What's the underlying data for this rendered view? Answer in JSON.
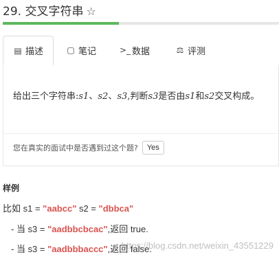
{
  "header": {
    "title": "29. 交叉字符串",
    "star_icon": "star-outline-icon",
    "progress_fraction": 0.42
  },
  "tabs": [
    {
      "label": "描述",
      "icon": "document-icon",
      "glyph": "▤",
      "active": true
    },
    {
      "label": "笔记",
      "icon": "note-icon",
      "glyph": "▢",
      "active": false
    },
    {
      "label": "数据",
      "icon": "terminal-icon",
      "glyph": ">_",
      "active": false
    },
    {
      "label": "评测",
      "icon": "scale-icon",
      "glyph": "⚖",
      "active": false
    }
  ],
  "problem": {
    "statement_parts": [
      "给出三个字符串:",
      "s1",
      "、",
      "s2",
      "、",
      "s3",
      ",判断",
      "s3",
      "是否由",
      "s1",
      "和",
      "s2",
      "交叉构成。"
    ],
    "question": "您在真实的面试中是否遇到过这个题?",
    "yes_button": "Yes"
  },
  "examples": {
    "header": "样例",
    "line1": {
      "prefix": "比如 s1 = ",
      "s1": "\"aabcc\"",
      "mid": " s2 = ",
      "s2": "\"dbbca\""
    },
    "line2": {
      "prefix": "- 当 s3 = ",
      "s3": "\"aadbbcbcac\"",
      "suffix": ",返回  true."
    },
    "line3": {
      "prefix": "- 当 s3 = ",
      "s3": "\"aadbbbaccc\"",
      "suffix": ",返回 false."
    }
  },
  "watermark": "https://blog.csdn.net/weixin_43551229"
}
